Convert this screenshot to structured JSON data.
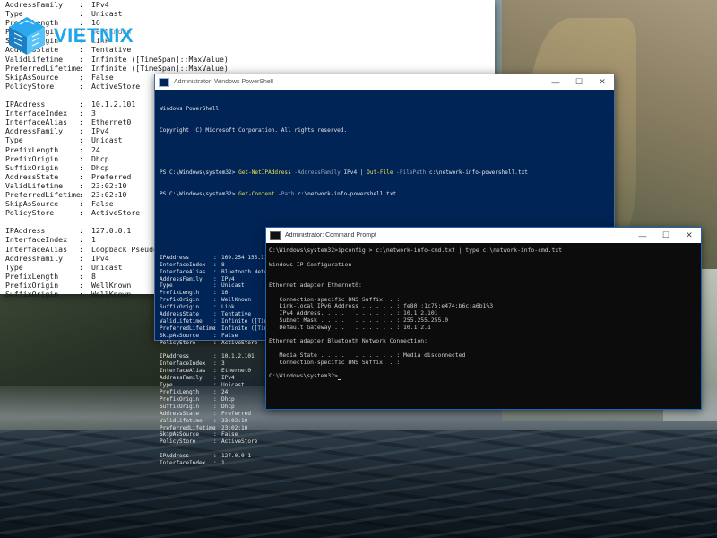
{
  "logo": {
    "text": "VIETNIX"
  },
  "back_window": {
    "lines": [
      {
        "key": "AddressFamily",
        "value": "IPv4"
      },
      {
        "key": "Type",
        "value": "Unicast"
      },
      {
        "key": "PrefixLength",
        "value": "16"
      },
      {
        "key": "PrefixOrigin",
        "value": "WellKnown"
      },
      {
        "key": "SuffixOrigin",
        "value": "Link"
      },
      {
        "key": "AddressState",
        "value": "Tentative"
      },
      {
        "key": "ValidLifetime",
        "value": "Infinite ([TimeSpan]::MaxValue)"
      },
      {
        "key": "PreferredLifetime",
        "value": "Infinite ([TimeSpan]::MaxValue)"
      },
      {
        "key": "SkipAsSource",
        "value": "False"
      },
      {
        "key": "PolicyStore",
        "value": "ActiveStore"
      },
      {
        "gap": true
      },
      {
        "key": "IPAddress",
        "value": "10.1.2.101"
      },
      {
        "key": "InterfaceIndex",
        "value": "3"
      },
      {
        "key": "InterfaceAlias",
        "value": "Ethernet0"
      },
      {
        "key": "AddressFamily",
        "value": "IPv4"
      },
      {
        "key": "Type",
        "value": "Unicast"
      },
      {
        "key": "PrefixLength",
        "value": "24"
      },
      {
        "key": "PrefixOrigin",
        "value": "Dhcp"
      },
      {
        "key": "SuffixOrigin",
        "value": "Dhcp"
      },
      {
        "key": "AddressState",
        "value": "Preferred"
      },
      {
        "key": "ValidLifetime",
        "value": "23:02:10"
      },
      {
        "key": "PreferredLifetime",
        "value": "23:02:10"
      },
      {
        "key": "SkipAsSource",
        "value": "False"
      },
      {
        "key": "PolicyStore",
        "value": "ActiveStore"
      },
      {
        "gap": true
      },
      {
        "key": "IPAddress",
        "value": "127.0.0.1"
      },
      {
        "key": "InterfaceIndex",
        "value": "1"
      },
      {
        "key": "InterfaceAlias",
        "value": "Loopback Pseudo-Interface 1"
      },
      {
        "key": "AddressFamily",
        "value": "IPv4"
      },
      {
        "key": "Type",
        "value": "Unicast"
      },
      {
        "key": "PrefixLength",
        "value": "8"
      },
      {
        "key": "PrefixOrigin",
        "value": "WellKnown"
      },
      {
        "key": "SuffixOrigin",
        "value": "WellKnown"
      }
    ]
  },
  "powershell": {
    "title": "Administrator: Windows PowerShell",
    "banner1": "Windows PowerShell",
    "banner2": "Copyright (C) Microsoft Corporation. All rights reserved.",
    "cmd1": {
      "prompt": "PS C:\\Windows\\system32> ",
      "cmdlet": "Get-NetIPAddress",
      "p1": " -AddressFamily ",
      "v1": "IPv4",
      "pipe": " | ",
      "cmdlet2": "Out-File",
      "p2": " -FilePath ",
      "v2": "c:\\network-info-powershell.txt"
    },
    "cmd2": {
      "prompt": "PS C:\\Windows\\system32> ",
      "cmdlet": "Get-Content",
      "p1": " -Path ",
      "v1": "c:\\network-info-powershell.txt"
    },
    "lines": [
      {
        "key": "IPAddress",
        "value": "169.254.155.119"
      },
      {
        "key": "InterfaceIndex",
        "value": "8"
      },
      {
        "key": "InterfaceAlias",
        "value": "Bluetooth Network Connection"
      },
      {
        "key": "AddressFamily",
        "value": "IPv4"
      },
      {
        "key": "Type",
        "value": "Unicast"
      },
      {
        "key": "PrefixLength",
        "value": "16"
      },
      {
        "key": "PrefixOrigin",
        "value": "WellKnown"
      },
      {
        "key": "SuffixOrigin",
        "value": "Link"
      },
      {
        "key": "AddressState",
        "value": "Tentative"
      },
      {
        "key": "ValidLifetime",
        "value": "Infinite ([TimeSpan]::MaxValue)"
      },
      {
        "key": "PreferredLifetime",
        "value": "Infinite ([TimeSpan]::MaxValue)"
      },
      {
        "key": "SkipAsSource",
        "value": "False"
      },
      {
        "key": "PolicyStore",
        "value": "ActiveStore"
      },
      {
        "gap": true
      },
      {
        "key": "IPAddress",
        "value": "10.1.2.101"
      },
      {
        "key": "InterfaceIndex",
        "value": "3"
      },
      {
        "key": "InterfaceAlias",
        "value": "Ethernet0"
      },
      {
        "key": "AddressFamily",
        "value": "IPv4"
      },
      {
        "key": "Type",
        "value": "Unicast"
      },
      {
        "key": "PrefixLength",
        "value": "24"
      },
      {
        "key": "PrefixOrigin",
        "value": "Dhcp"
      },
      {
        "key": "SuffixOrigin",
        "value": "Dhcp"
      },
      {
        "key": "AddressState",
        "value": "Preferred"
      },
      {
        "key": "ValidLifetime",
        "value": "23:02:10"
      },
      {
        "key": "PreferredLifetime",
        "value": "23:02:10"
      },
      {
        "key": "SkipAsSource",
        "value": "False"
      },
      {
        "key": "PolicyStore",
        "value": "ActiveStore"
      },
      {
        "gap": true
      },
      {
        "key": "IPAddress",
        "value": "127.0.0.1"
      },
      {
        "key": "InterfaceIndex",
        "value": "1"
      }
    ]
  },
  "cmd": {
    "title": "Administrator: Command Prompt",
    "lines": [
      "C:\\Windows\\system32>ipconfig > c:\\network-info-cmd.txt | type c:\\network-info-cmd.txt",
      "",
      "Windows IP Configuration",
      "",
      "",
      "Ethernet adapter Ethernet0:",
      "",
      "   Connection-specific DNS Suffix  . :",
      "   Link-local IPv6 Address . . . . . : fe80::1c75:e474:b6c:a6b1%3",
      "   IPv4 Address. . . . . . . . . . . : 10.1.2.101",
      "   Subnet Mask . . . . . . . . . . . : 255.255.255.0",
      "   Default Gateway . . . . . . . . . : 10.1.2.1",
      "",
      "Ethernet adapter Bluetooth Network Connection:",
      "",
      "   Media State . . . . . . . . . . . : Media disconnected",
      "   Connection-specific DNS Suffix  . :",
      "",
      "C:\\Windows\\system32>"
    ]
  },
  "window_controls": {
    "minimize": "—",
    "maximize": "☐",
    "close": "✕"
  }
}
